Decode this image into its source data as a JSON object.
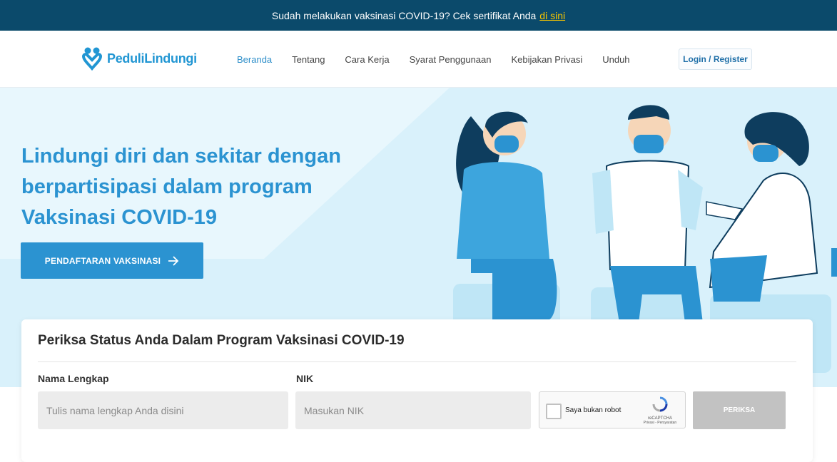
{
  "banner": {
    "text": "Sudah melakukan vaksinasi COVID-19? Cek sertifikat Anda",
    "link": "di sini"
  },
  "header": {
    "logo": "PeduliLindungi",
    "menu": [
      "Beranda",
      "Tentang",
      "Cara Kerja",
      "Syarat Penggunaan",
      "Kebijakan Privasi",
      "Unduh"
    ],
    "login": "Login / Register"
  },
  "hero": {
    "title": "Lindungi diri dan sekitar dengan berpartisipasi dalam program Vaksinasi COVID-19",
    "cta": "PENDAFTARAN VAKSINASI"
  },
  "check_form": {
    "title": "Periksa Status Anda Dalam Program Vaksinasi COVID-19",
    "name_label": "Nama Lengkap",
    "name_placeholder": "Tulis nama lengkap Anda disini",
    "nik_label": "NIK",
    "nik_placeholder": "Masukan NIK",
    "captcha_text": "Saya bukan robot",
    "captcha_brand": "reCAPTCHA",
    "captcha_links": "Privasi - Persyaratan",
    "submit": "PERIKSA"
  },
  "colors": {
    "banner_bg": "#0b4a6b",
    "brand": "#2b93d1",
    "hero_bg": "#d9f1fb",
    "link_yellow": "#f5c400"
  }
}
